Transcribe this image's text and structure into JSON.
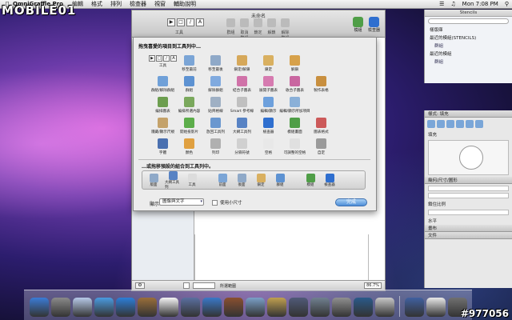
{
  "menubar": {
    "app_name": "OmniGraffle Pro",
    "menus": [
      "編輯",
      "格式",
      "排列",
      "檢查器",
      "視窗",
      "輔助說明"
    ],
    "status_right": "Mon 7:08 PM"
  },
  "watermark": "MOBILE01",
  "watermark_id": "#977056",
  "document": {
    "title": "未命名",
    "tool_label": "工具",
    "toolbar_labels": [
      "群組",
      "取消群組",
      "鎖定",
      "解鎖",
      "解除群組"
    ],
    "inspector_btns": [
      "檢查器",
      "模組"
    ],
    "status_selection": "所選範圍",
    "zoom": "86.7%"
  },
  "customize_sheet": {
    "heading": "拖曳喜愛的項目到工具列中…",
    "items": [
      {
        "label": "工具",
        "icon": "tools-group-icon",
        "color": "#dcdcdc"
      },
      {
        "label": "移至最前",
        "icon": "bring-front-icon",
        "color": "#7ba5d6"
      },
      {
        "label": "移至最後",
        "icon": "send-back-icon",
        "color": "#8fa9c8"
      },
      {
        "label": "鎖定/解鎖",
        "icon": "lock-unlock-icon",
        "color": "#d6a85a"
      },
      {
        "label": "鎖定",
        "icon": "lock-icon",
        "color": "#d9b060"
      },
      {
        "label": "解鎖",
        "icon": "unlock-icon",
        "color": "#d7a14a"
      },
      {
        "label": "",
        "icon": "",
        "color": ""
      },
      {
        "label": "",
        "icon": "",
        "color": ""
      },
      {
        "label": "群組/解除群組",
        "icon": "group-ungroup-icon",
        "color": "#6fa0d8"
      },
      {
        "label": "群組",
        "icon": "group-icon",
        "color": "#5d92d2"
      },
      {
        "label": "解除群組",
        "icon": "ungroup-icon",
        "color": "#80aadf"
      },
      {
        "label": "結合子圖表",
        "icon": "merge-subgraph-icon",
        "color": "#d072a8"
      },
      {
        "label": "展開子圖表",
        "icon": "expand-subgraph-icon",
        "color": "#d67bb0"
      },
      {
        "label": "收合子圖表",
        "icon": "collapse-subgraph-icon",
        "color": "#c966a0"
      },
      {
        "label": "製作表格",
        "icon": "make-table-icon",
        "color": "#c88f3f"
      },
      {
        "label": "",
        "icon": "",
        "color": ""
      },
      {
        "label": "編排圖表",
        "icon": "layout-diagram-icon",
        "color": "#6c9e4f"
      },
      {
        "label": "編排所選內容",
        "icon": "layout-selection-icon",
        "color": "#7aa85c"
      },
      {
        "label": "貼齊格線",
        "icon": "snap-grid-icon",
        "color": "#9fb0c4"
      },
      {
        "label": "Smart 參考線",
        "icon": "smart-guides-icon",
        "color": "#c0c0c0"
      },
      {
        "label": "編輯/顯示",
        "icon": "edit-display-icon",
        "color": "#6da0dc"
      },
      {
        "label": "編輯/顯示所加項目",
        "icon": "edit-added-icon",
        "color": "#8ab0d8"
      },
      {
        "label": "",
        "icon": "",
        "color": ""
      },
      {
        "label": "",
        "icon": "",
        "color": ""
      },
      {
        "label": "隱藏/顯示尺規",
        "icon": "rulers-icon",
        "color": "#c4a26a"
      },
      {
        "label": "開始投影片",
        "icon": "slideshow-icon",
        "color": "#5cad4a"
      },
      {
        "label": "放回工具列",
        "icon": "restore-toolbar-icon",
        "color": "#6a97cf"
      },
      {
        "label": "大網工具列",
        "icon": "outline-toolbar-icon",
        "color": "#5883c4"
      },
      {
        "label": "檢查器",
        "icon": "inspector-icon",
        "color": "#2f6fcf"
      },
      {
        "label": "模組畫面",
        "icon": "stencils-icon",
        "color": "#4f9e47"
      },
      {
        "label": "圖表格式",
        "icon": "diagram-style-icon",
        "color": "#cc5a5a"
      },
      {
        "label": "",
        "icon": "",
        "color": ""
      },
      {
        "label": "字體",
        "icon": "fonts-icon",
        "color": "#4a70b0"
      },
      {
        "label": "顏色",
        "icon": "colors-icon",
        "color": "#e0a040"
      },
      {
        "label": "列印",
        "icon": "print-icon",
        "color": "#b0b0b0"
      },
      {
        "label": "分隔符號",
        "icon": "separator-icon",
        "color": "#d0d0d0"
      },
      {
        "label": "空格",
        "icon": "space-icon",
        "color": "#e8e8e8"
      },
      {
        "label": "可調整的空格",
        "icon": "flexible-space-icon",
        "color": "#e0e0e0"
      },
      {
        "label": "自定",
        "icon": "customize-icon",
        "color": "#9a9a9a"
      },
      {
        "label": "",
        "icon": "",
        "color": ""
      }
    ],
    "default_label": "…或拖移預設的組合到工具列中。",
    "default_set": [
      "版面",
      "大網工具列",
      "工具",
      "前面",
      "後面",
      "鎖定",
      "群組",
      "模組",
      "檢查器"
    ],
    "show_label": "顯示",
    "show_value": "圖像與文字",
    "small_size_label": "使用小尺寸",
    "done_label": "完成"
  },
  "stencils": {
    "title": "Stencils",
    "rows": [
      "樣版庫",
      "最近的模組(STENCILS)",
      "群組",
      "最近的模組",
      "群組"
    ]
  },
  "inspector": {
    "title": "樣式: 填充",
    "fill_label": "填充",
    "geometry_label": "幾何/尺寸/圖形",
    "lock_label": "鎖住比例",
    "rotate_label": "水平",
    "canvas_label": "畫布",
    "doc_label": "文件"
  },
  "dock_count": 20
}
